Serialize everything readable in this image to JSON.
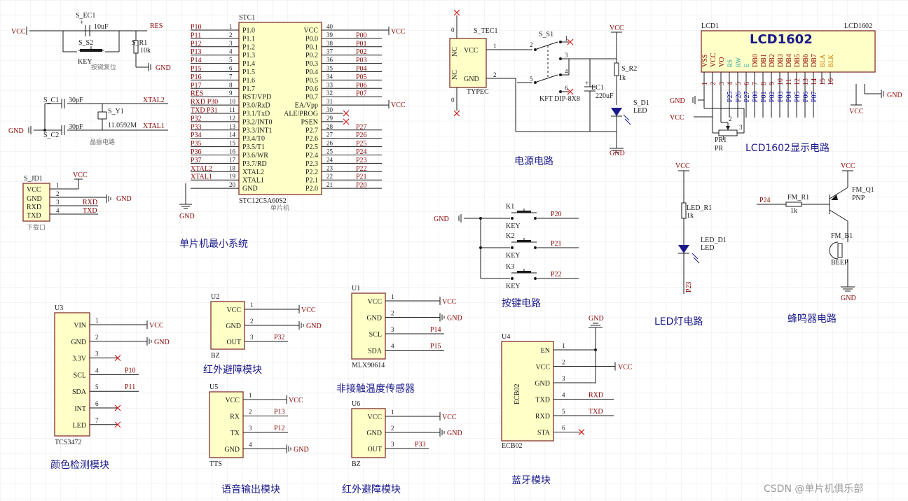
{
  "captions": {
    "mcu": "单片机最小系统",
    "power": "电源电路",
    "lcd": "LCD1602显示电路",
    "keys": "按键电路",
    "led": "LED灯电路",
    "buzzer": "蜂鸣器电路",
    "color": "颜色检测模块",
    "ir1": "红外避障模块",
    "voice": "语音输出模块",
    "temp": "非接触温度传感器",
    "ir2": "红外避障模块",
    "bt": "蓝牙模块",
    "reset_note": "按键复位",
    "crystal_note": "晶振电路",
    "download_note": "下载口"
  },
  "nets": {
    "vcc": "VCC",
    "gnd": "GND",
    "res": "RES",
    "xtal1": "XTAL1",
    "xtal2": "XTAL2",
    "rxd": "RXD",
    "txd": "TXD"
  },
  "reset": {
    "cap_ref": "S_EC1",
    "cap_val": "10uF",
    "sw_ref": "S_S2",
    "sw_val": "KEY",
    "res_ref": "S_R1",
    "res_val": "10k"
  },
  "crystal": {
    "c1_ref": "S_C1",
    "c1_val": "30pF",
    "c2_ref": "S_C2",
    "c2_val": "30pF",
    "y_ref": "S_Y1",
    "y_val": "11.0592M"
  },
  "download": {
    "ref": "S_JD1",
    "pins": [
      "VCC",
      "GND",
      "RXD",
      "TXD"
    ],
    "nums": [
      "1",
      "2",
      "3",
      "4"
    ]
  },
  "mcu": {
    "ref": "STC1",
    "part": "STC12C5A60S2",
    "sub": "单片机",
    "left": [
      {
        "n": "1",
        "name": "P1.0",
        "net": "P10"
      },
      {
        "n": "2",
        "name": "P1.1",
        "net": "P11"
      },
      {
        "n": "3",
        "name": "P1.2",
        "net": "P12"
      },
      {
        "n": "4",
        "name": "P1.3",
        "net": "P13"
      },
      {
        "n": "5",
        "name": "P1.4",
        "net": "P14"
      },
      {
        "n": "6",
        "name": "P1.5",
        "net": "P15"
      },
      {
        "n": "7",
        "name": "P1.6",
        "net": "P16"
      },
      {
        "n": "8",
        "name": "P1.7",
        "net": "P17"
      },
      {
        "n": "9",
        "name": "RST/VPD",
        "net": "RES"
      },
      {
        "n": "10",
        "name": "P3.0/RxD",
        "net": "RXD P30"
      },
      {
        "n": "11",
        "name": "P3.1/TxD",
        "net": "TXD P31"
      },
      {
        "n": "12",
        "name": "P3.2/INT0",
        "net": "P32"
      },
      {
        "n": "13",
        "name": "P3.3/INT1",
        "net": "P33"
      },
      {
        "n": "14",
        "name": "P3.4/T0",
        "net": "P34"
      },
      {
        "n": "15",
        "name": "P3.5/T1",
        "net": "P35"
      },
      {
        "n": "16",
        "name": "P3.6/WR",
        "net": "P36"
      },
      {
        "n": "17",
        "name": "P3.7/RD",
        "net": "P37"
      },
      {
        "n": "18",
        "name": "XTAL2",
        "net": "XTAL2"
      },
      {
        "n": "19",
        "name": "XTAL1",
        "net": "XTAL1"
      },
      {
        "n": "20",
        "name": "GND",
        "net": ""
      }
    ],
    "right": [
      {
        "n": "40",
        "name": "VCC",
        "net": "VCC"
      },
      {
        "n": "39",
        "name": "P0.0",
        "net": "P00"
      },
      {
        "n": "38",
        "name": "P0.1",
        "net": "P01"
      },
      {
        "n": "37",
        "name": "P0.2",
        "net": "P02"
      },
      {
        "n": "36",
        "name": "P0.3",
        "net": "P03"
      },
      {
        "n": "35",
        "name": "P0.4",
        "net": "P04"
      },
      {
        "n": "34",
        "name": "P0.5",
        "net": "P05"
      },
      {
        "n": "33",
        "name": "P0.6",
        "net": "P06"
      },
      {
        "n": "32",
        "name": "P0.7",
        "net": "P07"
      },
      {
        "n": "31",
        "name": "EA/Vpp",
        "net": "VCC"
      },
      {
        "n": "30",
        "name": "ALE/PROG",
        "net": ""
      },
      {
        "n": "29",
        "name": "PSEN",
        "net": ""
      },
      {
        "n": "28",
        "name": "P2.7",
        "net": "P27"
      },
      {
        "n": "27",
        "name": "P2.6",
        "net": "P26"
      },
      {
        "n": "26",
        "name": "P2.5",
        "net": "P25"
      },
      {
        "n": "25",
        "name": "P2.4",
        "net": "P24"
      },
      {
        "n": "24",
        "name": "P2.3",
        "net": "P23"
      },
      {
        "n": "23",
        "name": "P2.2",
        "net": "P22"
      },
      {
        "n": "22",
        "name": "P2.1",
        "net": "P21"
      },
      {
        "n": "21",
        "name": "P2.0",
        "net": "P20"
      }
    ]
  },
  "power": {
    "conn_ref": "S_TEC1",
    "conn_part": "TYPEC",
    "nc": "NC",
    "vcc": "VCC",
    "gnd": "GND",
    "sw_ref": "S_S1",
    "sw_part": "KFT DIP-8X8",
    "cap_ref": "EC1",
    "cap_val": "220uF",
    "r_ref": "S_R2",
    "r_val": "1k",
    "d_ref": "S_D1",
    "d_val": "LED",
    "pins": [
      "1",
      "2",
      "3",
      "4",
      "5",
      "6"
    ],
    "conn_pins": [
      "1",
      "2"
    ],
    "side_nums": [
      "0",
      "0"
    ]
  },
  "lcd": {
    "ref": "LCD1",
    "part": "LCD1602",
    "title": "LCD1602",
    "pins": [
      "VSS",
      "VCC",
      "VO",
      "RS",
      "RW",
      "E",
      "DB0",
      "DB1",
      "DB2",
      "DB3",
      "DB4",
      "DB5",
      "DB6",
      "DB7",
      "BLA",
      "BLK"
    ],
    "nums": [
      "1",
      "2",
      "3",
      "4",
      "5",
      "6",
      "7",
      "8",
      "9",
      "10",
      "11",
      "12",
      "13",
      "14",
      "15",
      "16"
    ],
    "nets": [
      "",
      "",
      "",
      "P25",
      "P26",
      "P27",
      "P00",
      "P01",
      "P02",
      "P03",
      "P04",
      "P05",
      "P06",
      "P07",
      "",
      ""
    ],
    "pot_ref": "PR1",
    "pot_part": "PR",
    "pot_pins": [
      "1",
      "2",
      "3"
    ]
  },
  "keys": [
    {
      "ref": "K1",
      "val": "KEY",
      "net": "P20"
    },
    {
      "ref": "K2",
      "val": "KEY",
      "net": "P21"
    },
    {
      "ref": "K3",
      "val": "KEY",
      "net": "P22"
    }
  ],
  "led": {
    "r_ref": "LED_R1",
    "r_val": "1k",
    "d_ref": "LED_D1",
    "d_val": "LED",
    "net": "P23"
  },
  "buzzer": {
    "net": "P24",
    "r_ref": "FM_R1",
    "r_val": "1k",
    "q_ref": "FM_Q1",
    "q_val": "PNP",
    "b_ref": "FM_B1",
    "b_val": "BEEP"
  },
  "u3": {
    "ref": "U3",
    "part": "TCS3472",
    "pins": [
      "VIN",
      "GND",
      "3.3V",
      "SCL",
      "SDA",
      "INT",
      "LED"
    ],
    "nums": [
      "1",
      "2",
      "3",
      "4",
      "5",
      "6",
      "7"
    ],
    "nets": [
      "VCC",
      "GND",
      "",
      "P10",
      "P11",
      "",
      ""
    ]
  },
  "u2": {
    "ref": "U2",
    "part": "BZ",
    "pins": [
      "VCC",
      "GND",
      "OUT"
    ],
    "nums": [
      "1",
      "2",
      "3"
    ],
    "nets": [
      "VCC",
      "GND",
      "P32"
    ]
  },
  "u5": {
    "ref": "U5",
    "part": "TTS",
    "pins": [
      "VCC",
      "RX",
      "TX",
      "GND"
    ],
    "nums": [
      "1",
      "2",
      "3",
      "4"
    ],
    "nets": [
      "VCC",
      "P13",
      "P12",
      "GND"
    ]
  },
  "u1": {
    "ref": "U1",
    "part": "MLX90614",
    "pins": [
      "VCC",
      "GND",
      "SCL",
      "SDA"
    ],
    "nums": [
      "1",
      "2",
      "3",
      "4"
    ],
    "nets": [
      "VCC",
      "GND",
      "P14",
      "P15"
    ]
  },
  "u6": {
    "ref": "U6",
    "part": "BZ",
    "pins": [
      "VCC",
      "GND",
      "OUT"
    ],
    "nums": [
      "1",
      "2",
      "3"
    ],
    "nets": [
      "VCC",
      "GND",
      "P33"
    ]
  },
  "u4": {
    "ref": "U4",
    "part": "ECB02",
    "body": "ECB02",
    "pins": [
      "EN",
      "VCC",
      "GND",
      "TXD",
      "RXD",
      "STA"
    ],
    "nums": [
      "1",
      "2",
      "3",
      "4",
      "5",
      "6"
    ],
    "nets": [
      "",
      "VCC",
      "",
      "RXD",
      "TXD",
      ""
    ],
    "gnd": "GND"
  },
  "watermark": "CSDN @单片机俱乐部"
}
